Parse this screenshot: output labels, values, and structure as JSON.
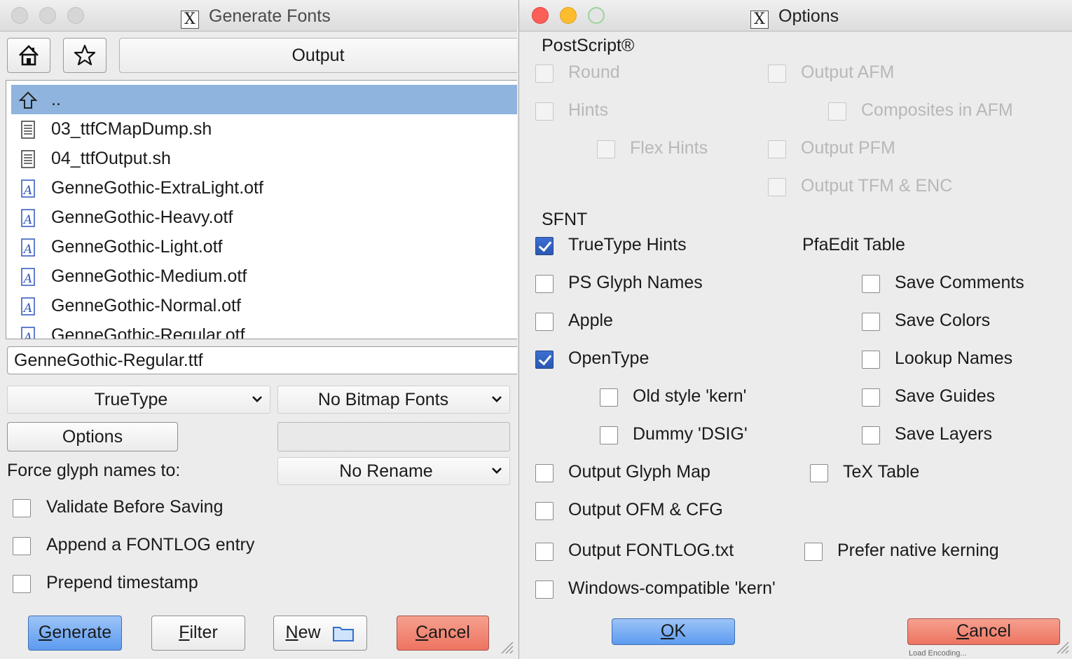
{
  "generate_window": {
    "title": "Generate Fonts",
    "path_button": "Output",
    "files": [
      {
        "name": "..",
        "icon": "up-arrow-icon",
        "selected": true
      },
      {
        "name": "03_ttfCMapDump.sh",
        "icon": "text-file-icon"
      },
      {
        "name": "04_ttfOutput.sh",
        "icon": "text-file-icon"
      },
      {
        "name": "GenneGothic-ExtraLight.otf",
        "icon": "font-file-icon"
      },
      {
        "name": "GenneGothic-Heavy.otf",
        "icon": "font-file-icon"
      },
      {
        "name": "GenneGothic-Light.otf",
        "icon": "font-file-icon"
      },
      {
        "name": "GenneGothic-Medium.otf",
        "icon": "font-file-icon"
      },
      {
        "name": "GenneGothic-Normal.otf",
        "icon": "font-file-icon"
      },
      {
        "name": "GenneGothic-Regular.otf",
        "icon": "font-file-icon"
      }
    ],
    "filename": "GenneGothic-Regular.ttf",
    "format_select": "TrueType",
    "bitmap_select": "No Bitmap Fonts",
    "options_button": "Options",
    "force_glyph_label": "Force glyph names to:",
    "rename_select": "No Rename",
    "checkboxes": {
      "validate": {
        "label": "Validate Before Saving",
        "checked": false
      },
      "fontlog": {
        "label": "Append a FONTLOG entry",
        "checked": false
      },
      "timestamp": {
        "label": "Prepend timestamp",
        "checked": false
      }
    },
    "buttons": {
      "generate_pre": "",
      "generate_u": "G",
      "generate_post": "enerate",
      "filter_u": "F",
      "filter_post": "ilter",
      "new_u": "N",
      "new_post": "ew",
      "cancel_u": "C",
      "cancel_post": "ancel"
    }
  },
  "options_window": {
    "title": "Options",
    "postscript": {
      "heading": "PostScript®",
      "round": {
        "label": "Round",
        "checked": false,
        "disabled": true
      },
      "hints": {
        "label": "Hints",
        "checked": false,
        "disabled": true
      },
      "flex_hints": {
        "label": "Flex Hints",
        "checked": false,
        "disabled": true
      },
      "output_afm": {
        "label": "Output AFM",
        "checked": false,
        "disabled": true
      },
      "composites_afm": {
        "label": "Composites in AFM",
        "checked": false,
        "disabled": true
      },
      "output_pfm": {
        "label": "Output PFM",
        "checked": false,
        "disabled": true
      },
      "output_tfm": {
        "label": "Output TFM & ENC",
        "checked": false,
        "disabled": true
      }
    },
    "sfnt": {
      "heading": "SFNT",
      "truetype_hints": {
        "label": "TrueType Hints",
        "checked": true
      },
      "ps_glyph_names": {
        "label": "PS Glyph Names",
        "checked": false
      },
      "apple": {
        "label": "Apple",
        "checked": false
      },
      "opentype": {
        "label": "OpenType",
        "checked": true
      },
      "old_style_kern": {
        "label": "Old style 'kern'",
        "checked": false
      },
      "dummy_dsig": {
        "label": "Dummy 'DSIG'",
        "checked": false
      },
      "output_glyph_map": {
        "label": "Output Glyph Map",
        "checked": false
      },
      "output_ofm": {
        "label": "Output OFM & CFG",
        "checked": false
      },
      "output_fontlog": {
        "label": "Output FONTLOG.txt",
        "checked": false
      },
      "windows_kern": {
        "label": "Windows-compatible 'kern'",
        "checked": false
      }
    },
    "pfaedit": {
      "heading": "PfaEdit Table",
      "save_comments": {
        "label": "Save Comments",
        "checked": false
      },
      "save_colors": {
        "label": "Save Colors",
        "checked": false
      },
      "lookup_names": {
        "label": "Lookup Names",
        "checked": false
      },
      "save_guides": {
        "label": "Save Guides",
        "checked": false
      },
      "save_layers": {
        "label": "Save Layers",
        "checked": false
      }
    },
    "tex_table": {
      "label": "TeX Table",
      "checked": false
    },
    "prefer_native": {
      "label": "Prefer native kerning",
      "checked": false
    },
    "ok_u": "O",
    "ok_post": "K",
    "cancel_u": "C",
    "cancel_post": "ancel",
    "status_text": "Load Encoding..."
  },
  "colors": {
    "selection": "#8fb4de",
    "primary_button": "#5d9bf0",
    "cancel_button": "#ed7461",
    "checkbox_checked": "#2a58b3"
  }
}
